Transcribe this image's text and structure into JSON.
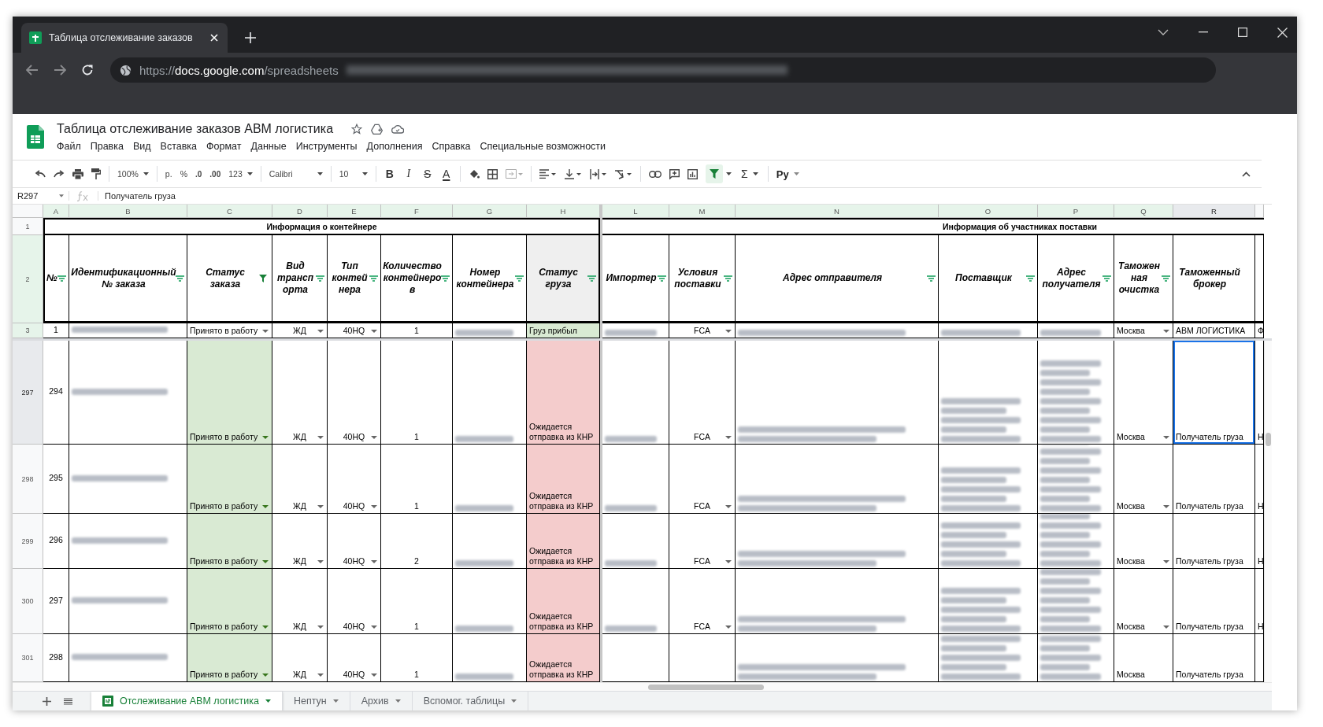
{
  "browser": {
    "tab_title": "Таблица отслеживание заказов",
    "url": {
      "scheme": "https://",
      "host": "docs.google.com",
      "path": "/spreadsheets",
      "redacted_tail": true
    }
  },
  "doc": {
    "title": "Таблица отслеживание заказов АВМ логистика"
  },
  "menu": [
    "Файл",
    "Правка",
    "Вид",
    "Вставка",
    "Формат",
    "Данные",
    "Инструменты",
    "Дополнения",
    "Справка",
    "Специальные возможности"
  ],
  "toolbar": {
    "zoom": "100%",
    "currency": "р.",
    "percent": "%",
    "dec_less": ".0",
    "dec_more": ".00",
    "number_format": "123",
    "font": "Calibri",
    "font_size": "10",
    "bold": "B",
    "italic": "I",
    "strike": "S",
    "text_color": "A",
    "filter_on": true,
    "functions": "Σ",
    "input_tool": "Ру"
  },
  "formula_bar": {
    "cell": "R297",
    "value": "Получатель груза"
  },
  "columns": [
    {
      "letter": "A",
      "selected": false
    },
    {
      "letter": "B",
      "selected": false
    },
    {
      "letter": "C",
      "selected": false
    },
    {
      "letter": "D",
      "selected": false
    },
    {
      "letter": "E",
      "selected": false
    },
    {
      "letter": "F",
      "selected": false
    },
    {
      "letter": "G",
      "selected": false
    },
    {
      "letter": "H",
      "selected": false
    },
    {
      "letter": "L",
      "selected": false
    },
    {
      "letter": "M",
      "selected": false
    },
    {
      "letter": "N",
      "selected": false
    },
    {
      "letter": "O",
      "selected": false
    },
    {
      "letter": "P",
      "selected": false
    },
    {
      "letter": "Q",
      "selected": false
    },
    {
      "letter": "R",
      "selected": true
    }
  ],
  "group_row": {
    "number": "1",
    "groups": [
      "Информация о контейнере",
      "Информация об участниках поставки"
    ]
  },
  "header_row": {
    "number": "2",
    "cells": [
      {
        "text": "№",
        "has_filter": true,
        "filter_active": false
      },
      {
        "text": "Идентификационный № заказа",
        "has_filter": true,
        "filter_active": false
      },
      {
        "text": "Статус заказа",
        "has_filter": true,
        "filter_active": true
      },
      {
        "text": "Вид трансп орта",
        "has_filter": true,
        "filter_active": false
      },
      {
        "text": "Тип контей нера",
        "has_filter": true,
        "filter_active": false
      },
      {
        "text": "Количество контейнеро в",
        "has_filter": true,
        "filter_active": false
      },
      {
        "text": "Номер контейнера",
        "has_filter": true,
        "filter_active": false
      },
      {
        "text": "Статус груза",
        "has_filter": true,
        "filter_active": false,
        "color": "#efefef"
      },
      {
        "text": "Импортер",
        "has_filter": true,
        "filter_active": false
      },
      {
        "text": "Условия поставки",
        "has_filter": true,
        "filter_active": false
      },
      {
        "text": "Адрес отправителя",
        "has_filter": true,
        "filter_active": false
      },
      {
        "text": "Поставщик",
        "has_filter": true,
        "filter_active": false
      },
      {
        "text": "Адрес получателя",
        "has_filter": true,
        "filter_active": false
      },
      {
        "text": "Таможен ная очистка",
        "has_filter": true,
        "filter_active": false
      },
      {
        "text": "Таможенный брокер",
        "has_filter": false,
        "filter_active": false
      }
    ]
  },
  "rows": [
    {
      "number": "3",
      "selected": false,
      "cells": [
        {
          "text": "1"
        },
        {
          "redacted": true
        },
        {
          "text": "Принято в работу",
          "dropdown": true
        },
        {
          "text": "ЖД",
          "dropdown": true
        },
        {
          "text": "40HQ",
          "dropdown": true
        },
        {
          "text": "1"
        },
        {
          "redacted": true
        },
        {
          "text": "Груз прибыл",
          "color": "#d9ead3"
        },
        {
          "redacted": true
        },
        {
          "text": "FCA",
          "dropdown": true
        },
        {
          "redacted": true
        },
        {
          "redacted": true
        },
        {
          "redacted": true
        },
        {
          "text": "Москва",
          "dropdown": true
        },
        {
          "text": "АВМ ЛОГИСТИКА"
        },
        {
          "text": "Ф"
        }
      ]
    },
    {
      "number": "297",
      "selected": true,
      "cells": [
        {
          "text": "294"
        },
        {
          "redacted": true
        },
        {
          "text": "Принято в работу",
          "dropdown": true,
          "color": "#d9ead3"
        },
        {
          "text": "ЖД",
          "dropdown": true
        },
        {
          "text": "40HQ",
          "dropdown": true
        },
        {
          "text": "1"
        },
        {
          "redacted": true
        },
        {
          "text": "Ожидается отправка из КНР",
          "color": "#f4cccc"
        },
        {
          "redacted": true
        },
        {
          "text": "FCA",
          "dropdown": true
        },
        {
          "redacted": true
        },
        {
          "redacted": true
        },
        {
          "redacted": true
        },
        {
          "text": "Москва",
          "dropdown": true
        },
        {
          "text": "Получатель груза"
        },
        {
          "text": "Н"
        }
      ]
    },
    {
      "number": "298",
      "selected": false,
      "cells": [
        {
          "text": "295"
        },
        {
          "redacted": true
        },
        {
          "text": "Принято в работу",
          "dropdown": true,
          "color": "#d9ead3"
        },
        {
          "text": "ЖД",
          "dropdown": true
        },
        {
          "text": "40HQ",
          "dropdown": true
        },
        {
          "text": "1"
        },
        {
          "redacted": true
        },
        {
          "text": "Ожидается отправка из КНР",
          "color": "#f4cccc"
        },
        {
          "redacted": true
        },
        {
          "text": "FCA",
          "dropdown": true
        },
        {
          "redacted": true
        },
        {
          "redacted": true
        },
        {
          "redacted": true
        },
        {
          "text": "Москва",
          "dropdown": true
        },
        {
          "text": "Получатель груза"
        },
        {
          "text": "Н"
        }
      ]
    },
    {
      "number": "299",
      "selected": false,
      "cells": [
        {
          "text": "296"
        },
        {
          "redacted": true
        },
        {
          "text": "Принято в работу",
          "dropdown": true,
          "color": "#d9ead3"
        },
        {
          "text": "ЖД",
          "dropdown": true
        },
        {
          "text": "40HQ",
          "dropdown": true
        },
        {
          "text": "2"
        },
        {
          "redacted": true
        },
        {
          "text": "Ожидается отправка из КНР",
          "color": "#f4cccc"
        },
        {
          "redacted": true
        },
        {
          "text": "FCA",
          "dropdown": true
        },
        {
          "redacted": true
        },
        {
          "redacted": true
        },
        {
          "redacted": true
        },
        {
          "text": "Москва",
          "dropdown": true
        },
        {
          "text": "Получатель груза"
        },
        {
          "text": "Н"
        }
      ]
    },
    {
      "number": "300",
      "selected": false,
      "cells": [
        {
          "text": "297"
        },
        {
          "redacted": true
        },
        {
          "text": "Принято в работу",
          "dropdown": true,
          "color": "#d9ead3"
        },
        {
          "text": "ЖД",
          "dropdown": true
        },
        {
          "text": "40HQ",
          "dropdown": true
        },
        {
          "text": "1"
        },
        {
          "redacted": true
        },
        {
          "text": "Ожидается отправка из КНР",
          "color": "#f4cccc"
        },
        {
          "redacted": true
        },
        {
          "text": "FCA",
          "dropdown": true
        },
        {
          "redacted": true
        },
        {
          "redacted": true
        },
        {
          "redacted": true
        },
        {
          "text": "Москва",
          "dropdown": true
        },
        {
          "text": "Получатель груза"
        },
        {
          "text": "Н"
        }
      ]
    },
    {
      "number": "301",
      "selected": false,
      "cells": [
        {
          "text": "298"
        },
        {
          "redacted": true
        },
        {
          "text": "Принято в работу",
          "dropdown": true,
          "color": "#d9ead3"
        },
        {
          "text": "ЖД",
          "dropdown": true
        },
        {
          "text": "40HQ",
          "dropdown": true
        },
        {
          "text": "1"
        },
        {
          "redacted": true
        },
        {
          "text": "Ожидается отправка из КНР",
          "color": "#f4cccc"
        },
        {},
        {},
        {
          "redacted": true
        },
        {
          "redacted": true
        },
        {
          "redacted": true
        },
        {
          "text": "Москва",
          "dropdown": false
        },
        {
          "text": "Получатель груза"
        },
        {}
      ]
    }
  ],
  "sheet_tabs": [
    {
      "label": "Отслеживание АВМ логистика",
      "selected": true
    },
    {
      "label": "Нептун",
      "selected": false
    },
    {
      "label": "Архив",
      "selected": false
    },
    {
      "label": "Вспомог. таблицы",
      "selected": false
    }
  ]
}
